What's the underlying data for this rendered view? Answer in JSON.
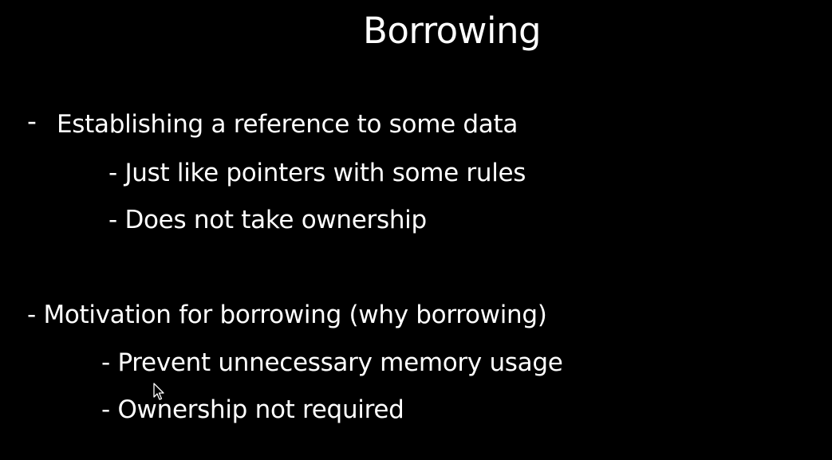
{
  "slide": {
    "title": "Borrowing",
    "bullet1": {
      "marker": "-",
      "text": "Establishing a reference to some data",
      "sub": [
        "- Just like pointers with some rules",
        "- Does not take ownership"
      ]
    },
    "bullet2": {
      "text": "- Motivation for borrowing (why borrowing)",
      "sub": [
        "- Prevent unnecessary memory usage",
        "- Ownership not required"
      ]
    }
  },
  "colors": {
    "background": "#000000",
    "text": "#ffffff"
  },
  "icons": {
    "cursor": "mouse-pointer-icon"
  }
}
